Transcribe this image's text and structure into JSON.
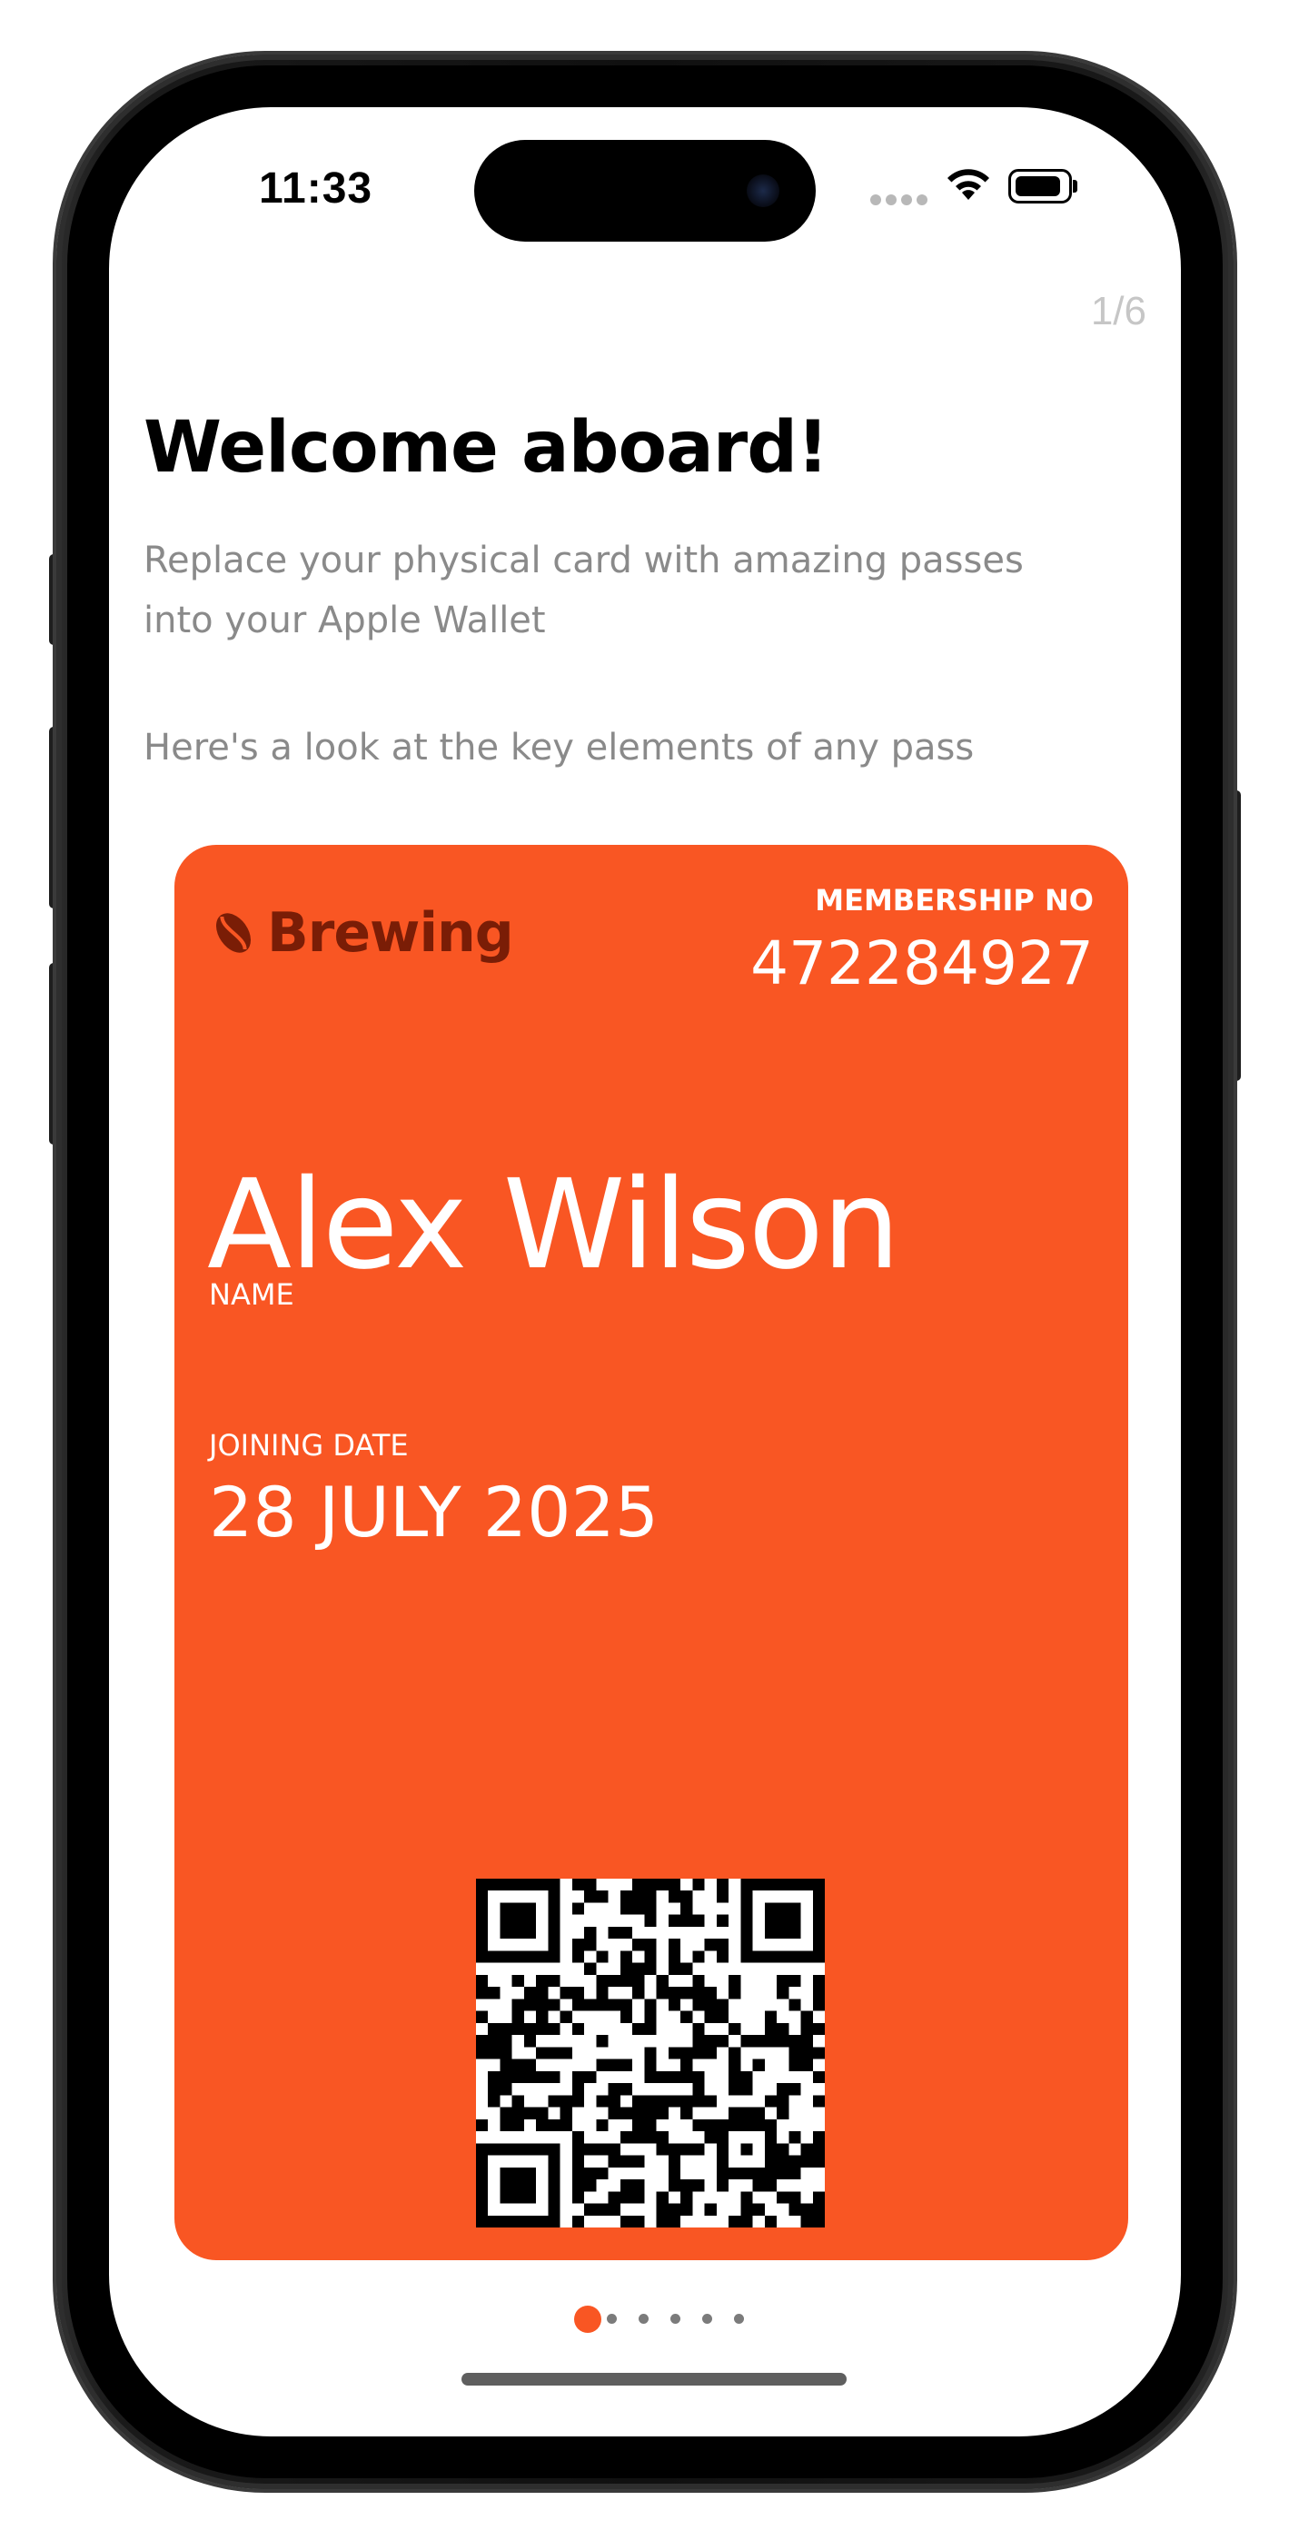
{
  "status_bar": {
    "time": "11:33",
    "signal_icon": "signal-dots-icon",
    "wifi_icon": "wifi-icon",
    "battery_icon": "battery-icon",
    "battery_level": 0.85
  },
  "onboarding": {
    "page_counter": "1/6",
    "title": "Welcome aboard!",
    "subtitle_line1": "Replace your physical card with amazing passes",
    "subtitle_line2": "into your Apple Wallet",
    "subtitle2": "Here's a look at the key elements of any pass",
    "current_page": 1,
    "total_pages": 6
  },
  "pass": {
    "background_color": "#f95623",
    "brand": {
      "name": "Brewing",
      "logo_icon": "coffee-bean-icon",
      "color": "#7a1d06"
    },
    "membership_label": "MEMBERSHIP NO",
    "membership_number": "472284927",
    "holder_name": "Alex Wilson",
    "name_label": "NAME",
    "joining_label": "JOINING DATE",
    "joining_date": "28 JULY 2025",
    "barcode_icon": "qr-code-icon"
  },
  "colors": {
    "accent": "#f95623",
    "title_text": "#000000",
    "secondary_text": "#8a8a8a",
    "page_counter_text": "#c6c6c6",
    "dot_inactive": "#7b7b7b"
  }
}
